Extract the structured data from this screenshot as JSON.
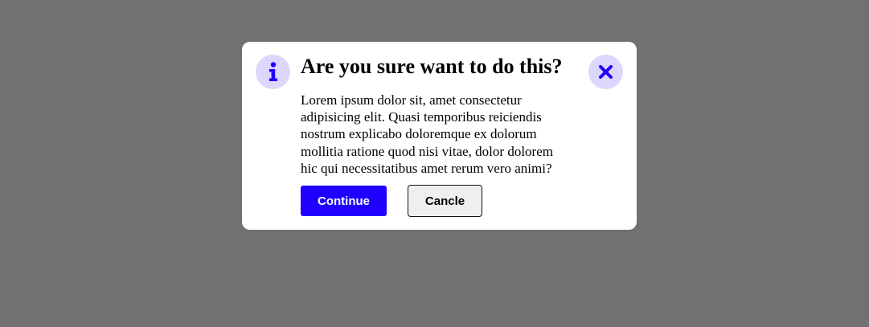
{
  "colors": {
    "overlay": "#717171",
    "dialog_bg": "#ffffff",
    "accent": "#1f00ff",
    "icon_bg": "#ddd6fe",
    "cancel_bg": "#efefef"
  },
  "dialog": {
    "icon": "info-icon",
    "close_icon": "close-icon",
    "title": "Are you sure want to do this?",
    "message": "Lorem ipsum dolor sit, amet consectetur adipisicing elit. Quasi temporibus reiciendis nostrum explicabo doloremque ex dolorum mollitia ratione quod nisi vitae, dolor dolorem hic qui necessitatibus amet rerum vero animi?",
    "continue_label": "Continue",
    "cancel_label": "Cancle"
  }
}
